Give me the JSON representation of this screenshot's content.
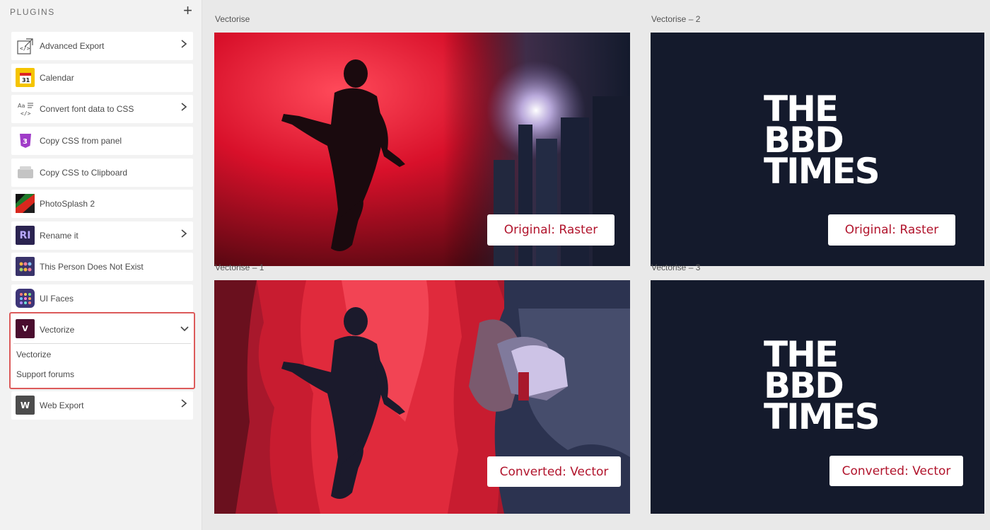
{
  "sidebar": {
    "title": "PLUGINS",
    "add_label": "+",
    "items": [
      {
        "label": "Advanced Export",
        "icon": "code-export-icon",
        "has_chevron": true
      },
      {
        "label": "Calendar",
        "icon": "calendar-icon",
        "icon_text": "31",
        "has_chevron": false
      },
      {
        "label": "Convert font data to CSS",
        "icon": "font-css-icon",
        "has_chevron": true
      },
      {
        "label": "Copy CSS from panel",
        "icon": "css3-icon",
        "has_chevron": false
      },
      {
        "label": "Copy CSS to Clipboard",
        "icon": "clipboard-icon",
        "has_chevron": false
      },
      {
        "label": "PhotoSplash 2",
        "icon": "photosplash-icon",
        "has_chevron": false
      },
      {
        "label": "Rename it",
        "icon": "rename-it-icon",
        "icon_text": "RI",
        "has_chevron": true
      },
      {
        "label": "This Person Does Not Exist",
        "icon": "people-icon",
        "has_chevron": false
      },
      {
        "label": "UI Faces",
        "icon": "ui-faces-icon",
        "has_chevron": false
      }
    ],
    "expanded": {
      "label": "Vectorize",
      "icon": "vectorize-icon",
      "icon_text": "V",
      "subitems": [
        "Vectorize",
        "Support forums"
      ]
    },
    "last_item": {
      "label": "Web Export",
      "icon": "web-export-icon",
      "icon_text": "W",
      "has_chevron": true
    }
  },
  "canvas": {
    "artboards": [
      {
        "title": "Vectorise",
        "tag": "Original: Raster"
      },
      {
        "title": "Vectorise – 2",
        "tag": "Original: Raster",
        "logo": [
          "THE",
          "BBD",
          "TIMES"
        ]
      },
      {
        "title": "Vectorise – 1",
        "tag": "Converted: Vector"
      },
      {
        "title": "Vectorise – 3",
        "tag": "Converted: Vector",
        "logo": [
          "THE",
          "BBD",
          "TIMES"
        ]
      }
    ]
  },
  "colors": {
    "accent_red": "#b1142c",
    "highlight_border": "#dc5a5a",
    "dark_navy": "#141a2c"
  }
}
